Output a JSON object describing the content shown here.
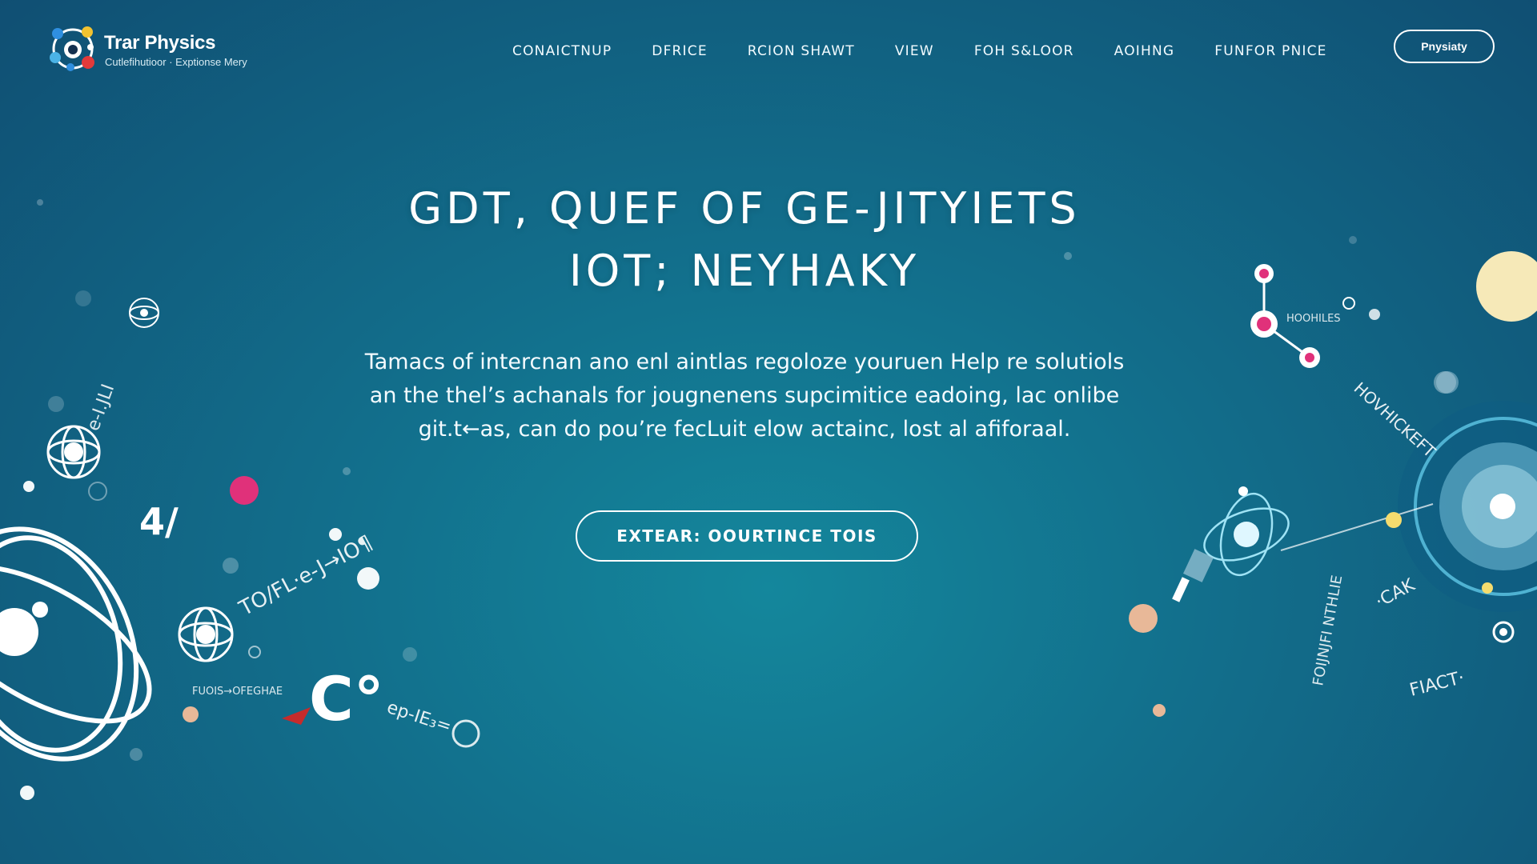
{
  "brand": {
    "name": "Trar Physics",
    "tagline": "Cutlefihutioor · Exptionse Mery"
  },
  "nav": {
    "items": [
      {
        "label": "CONAICTNUP"
      },
      {
        "label": "DFRICE"
      },
      {
        "label": "RCION SHAWT"
      },
      {
        "label": "VIEW"
      },
      {
        "label": "FOH S&LOOR"
      },
      {
        "label": "AOIHNG"
      },
      {
        "label": "FUNFOR PNICE"
      }
    ],
    "cta_label": "Pnysiaty"
  },
  "hero": {
    "title_line1": "GDT, QUEF OF GE-JITYIETS",
    "title_line2": "IOT; NEYHAKY",
    "body_line1": "Tamacs of intercnan ano enl aintlas regoloze youruen Help re solutiols",
    "body_line2": "an the thel’s achanals for jougnenens supcimitice eadoing, lac onlibe",
    "body_line3": "git.t←as, can do pou’re fecLuit elow actainc, lost al afiforaal.",
    "cta_label": "EXTEAR: OOURTINCE TOIS"
  },
  "decor_labels": {
    "left_arc_top": "e-I.JLI",
    "left_glyph": "4/",
    "left_formula": "TO/FL·e-J→IO¶",
    "left_small": "FUOIS→OFEGHAE",
    "left_co": "C°",
    "left_eq": "ep-IE₃=",
    "right_small": "HOOHILES",
    "right_diag": "HOVHICKEFT",
    "right_vert": "FOIJNJFI NTHLIE",
    "right_ca": "·CAK",
    "right_fact": "FIACT·"
  },
  "colors": {
    "background_center": "#14879c",
    "background_edge": "#104f73",
    "text": "#ffffff",
    "accent_pink": "#e0317a",
    "accent_yellow": "#f5dc6e",
    "accent_peach": "#e8b898"
  },
  "icons": {
    "logo": "atom-logo-icon",
    "left_atoms": "atom-orbit-icon",
    "right_planet": "planet-orbit-icon",
    "molecules": "molecule-icon"
  }
}
